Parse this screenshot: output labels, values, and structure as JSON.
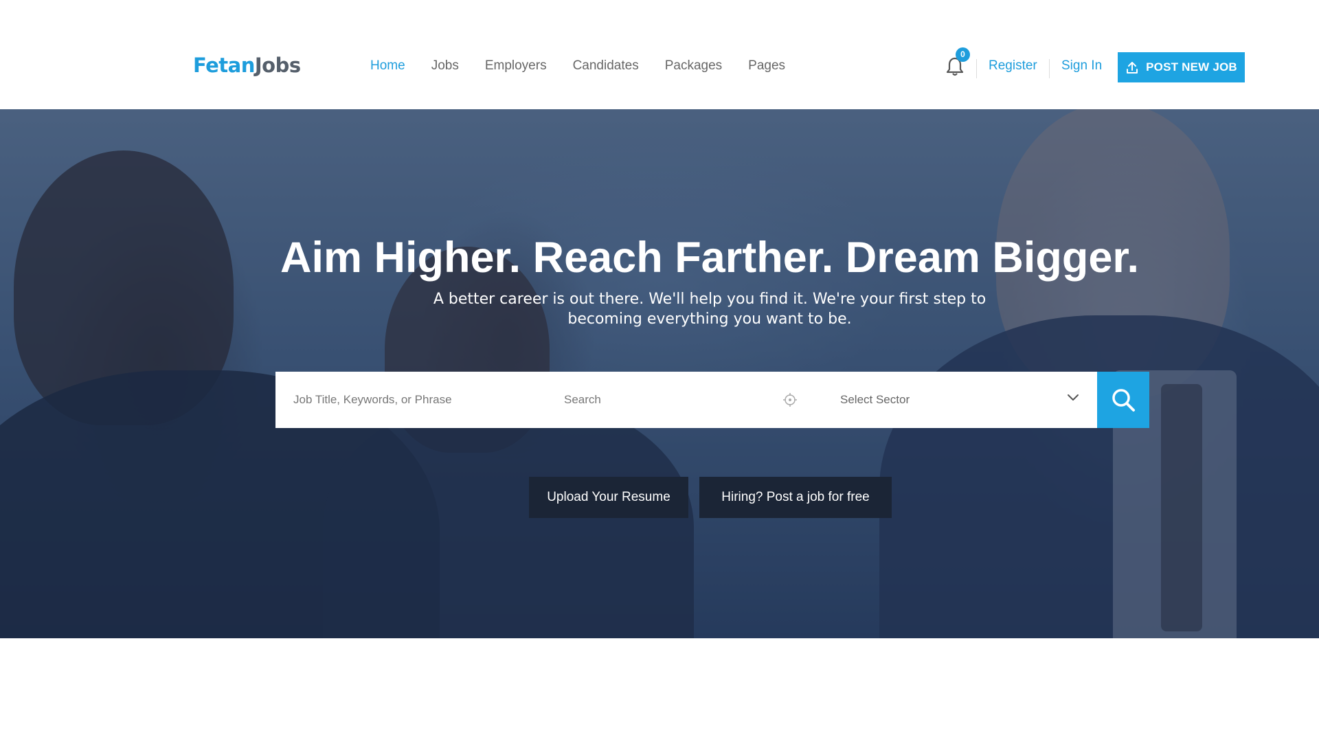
{
  "brand": {
    "part1": "Fetan",
    "part2": "Jobs"
  },
  "nav": {
    "items": [
      {
        "label": "Home",
        "active": true
      },
      {
        "label": "Jobs",
        "active": false
      },
      {
        "label": "Employers",
        "active": false
      },
      {
        "label": "Candidates",
        "active": false
      },
      {
        "label": "Packages",
        "active": false
      },
      {
        "label": "Pages",
        "active": false
      }
    ]
  },
  "header": {
    "notification_count": "0",
    "register_label": "Register",
    "signin_label": "Sign In",
    "post_job_label": "POST NEW JOB",
    "icons": {
      "notification": "bell-icon",
      "post_job": "upload-icon"
    }
  },
  "hero": {
    "title": "Aim Higher. Reach Farther. Dream Bigger.",
    "subtitle": "A better career is out there. We'll help you find it. We're your first step to becoming everything you want to be."
  },
  "search": {
    "keyword_placeholder": "Job Title, Keywords, or Phrase",
    "location_placeholder": "Search",
    "sector_selected": "Select Sector",
    "icons": {
      "location": "crosshair-icon",
      "sector": "chevron-down-icon",
      "submit": "search-icon"
    }
  },
  "cta": {
    "upload_label": "Upload Your Resume",
    "post_label": "Hiring? Post a job for free"
  },
  "colors": {
    "accent": "#1ea4e2",
    "logo_dark": "#555f6b",
    "cta_bg": "#1b2536"
  }
}
